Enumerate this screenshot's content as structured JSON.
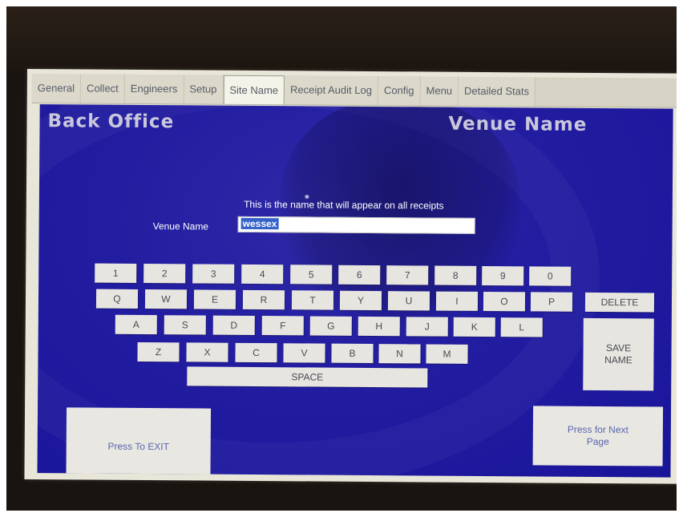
{
  "tabs": [
    {
      "label": "General",
      "active": false
    },
    {
      "label": "Collect",
      "active": false
    },
    {
      "label": "Engineers",
      "active": false
    },
    {
      "label": "Setup",
      "active": false
    },
    {
      "label": "Site Name",
      "active": true
    },
    {
      "label": "Receipt Audit Log",
      "active": false
    },
    {
      "label": "Config",
      "active": false
    },
    {
      "label": "Menu",
      "active": false
    },
    {
      "label": "Detailed Stats",
      "active": false
    }
  ],
  "header": {
    "left_title": "Back Office",
    "right_title": "Venue Name"
  },
  "form": {
    "instruction": "This is the name that will appear on all receipts",
    "venue_label": "Venue Name",
    "venue_value": "wessex"
  },
  "keyboard": {
    "row1": [
      "1",
      "2",
      "3",
      "4",
      "5",
      "6",
      "7",
      "8",
      "9",
      "0"
    ],
    "row2": [
      "Q",
      "W",
      "E",
      "R",
      "T",
      "Y",
      "U",
      "I",
      "O",
      "P"
    ],
    "row3": [
      "A",
      "S",
      "D",
      "F",
      "G",
      "H",
      "J",
      "K",
      "L"
    ],
    "row4": [
      "Z",
      "X",
      "C",
      "V",
      "B",
      "N",
      "M"
    ],
    "space": "SPACE",
    "delete": "DELETE",
    "save_line1": "SAVE",
    "save_line2": "NAME"
  },
  "buttons": {
    "exit": "Press To EXIT",
    "next_line1": "Press for Next",
    "next_line2": "Page"
  },
  "colors": {
    "panel_blue": "#221ca0",
    "key_bg": "#e6e5df",
    "tab_bg": "#dcd9cb"
  }
}
